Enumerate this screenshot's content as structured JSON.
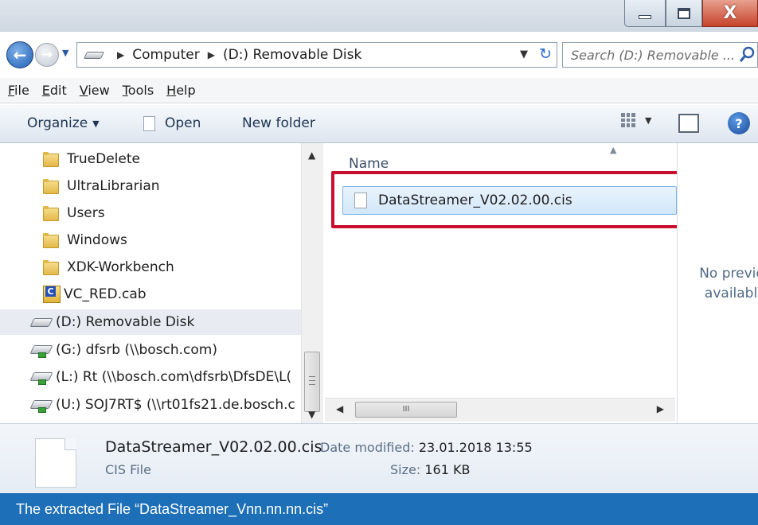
{
  "window": {
    "minimize_symbol": "_",
    "close_symbol": "X"
  },
  "address": {
    "crumbs": [
      "Computer",
      "(D:) Removable Disk"
    ],
    "separator": "▶",
    "dropdown_symbol": "▼",
    "refresh_symbol": "↻"
  },
  "search": {
    "placeholder": "Search (D:) Removable ..."
  },
  "menu": {
    "items": [
      {
        "hotkey": "F",
        "rest": "ile"
      },
      {
        "hotkey": "E",
        "rest": "dit"
      },
      {
        "hotkey": "V",
        "rest": "iew"
      },
      {
        "hotkey": "T",
        "rest": "ools"
      },
      {
        "hotkey": "H",
        "rest": "elp"
      }
    ]
  },
  "toolbar": {
    "organize": "Organize",
    "open": "Open",
    "new_folder": "New folder",
    "caret": "▼",
    "help": "?"
  },
  "nav_tree": {
    "items": [
      {
        "label": "TrueDelete",
        "icon": "folder-icon"
      },
      {
        "label": "UltraLibrarian",
        "icon": "folder-icon"
      },
      {
        "label": "Users",
        "icon": "folder-icon"
      },
      {
        "label": "Windows",
        "icon": "folder-icon"
      },
      {
        "label": "XDK-Workbench",
        "icon": "folder-icon"
      },
      {
        "label": "VC_RED.cab",
        "icon": "cab-file-icon"
      },
      {
        "label": "(D:) Removable Disk",
        "icon": "removable-drive-icon",
        "selected": true
      },
      {
        "label": "(G:) dfsrb (\\\\bosch.com)",
        "icon": "network-drive-icon"
      },
      {
        "label": "(L:) Rt (\\\\bosch.com\\dfsrb\\DfsDE\\L(",
        "icon": "network-drive-icon"
      },
      {
        "label": "(U:) SOJ7RT$ (\\\\rt01fs21.de.bosch.c",
        "icon": "network-drive-icon"
      }
    ]
  },
  "file_list": {
    "column_header": "Name",
    "files": [
      {
        "name": "DataStreamer_V02.02.00.cis",
        "selected": true
      }
    ]
  },
  "preview": {
    "line1": "No preview",
    "line2": "available."
  },
  "details": {
    "filename": "DataStreamer_V02.02.00.cis",
    "type": "CIS File",
    "modified_label": "Date modified:",
    "modified_value": "23.01.2018 13:55",
    "size_label": "Size:",
    "size_value": "161 KB"
  },
  "caption": "The extracted File “DataStreamer_Vnn.nn.nn.cis”",
  "colors": {
    "caption_bg": "#1d6fb8",
    "highlight_box": "#c8102e",
    "selection": "#d3e7fa"
  }
}
